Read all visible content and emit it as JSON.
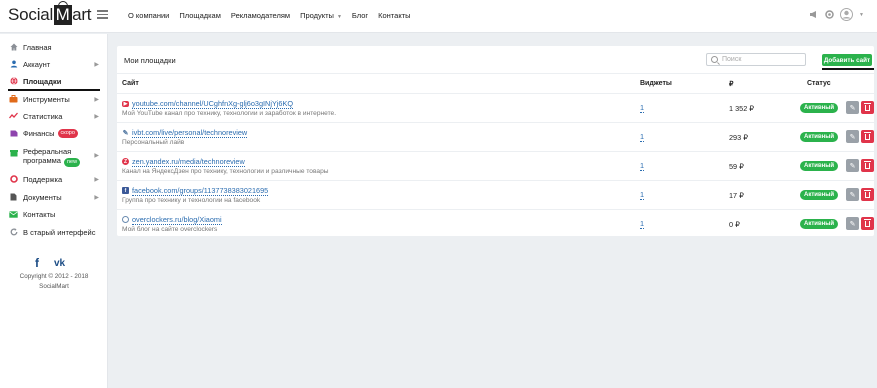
{
  "header": {
    "logo_pre": "Social",
    "logo_m": "M",
    "logo_post": "art",
    "nav": [
      "О компании",
      "Площадкам",
      "Рекламодателям",
      "Продукты",
      "Блог",
      "Контакты"
    ]
  },
  "sidebar": {
    "items": [
      {
        "label": "Главная",
        "icon": "home-icon",
        "color": "#8a8f96",
        "arrow": false
      },
      {
        "label": "Аккаунт",
        "icon": "user-icon",
        "color": "#2a6cb0",
        "arrow": true
      },
      {
        "label": "Площадки",
        "icon": "globe-icon",
        "color": "#e0344a",
        "arrow": false,
        "active": true
      },
      {
        "label": "Инструменты",
        "icon": "briefcase-icon",
        "color": "#e06a1a",
        "arrow": true
      },
      {
        "label": "Статистика",
        "icon": "chart-icon",
        "color": "#e0344a",
        "arrow": true
      },
      {
        "label": "Финансы",
        "icon": "wallet-icon",
        "color": "#8e44ad",
        "arrow": false,
        "badge": "скоро"
      },
      {
        "label": "Реферальная",
        "label2": "программа",
        "icon": "referral-icon",
        "color": "#2bb24c",
        "arrow": true,
        "badge": "new"
      },
      {
        "label": "Поддержка",
        "icon": "lifebuoy-icon",
        "color": "#e0344a",
        "arrow": true
      },
      {
        "label": "Документы",
        "icon": "document-icon",
        "color": "#555555",
        "arrow": true
      },
      {
        "label": "Контакты",
        "icon": "mail-icon",
        "color": "#2bb24c",
        "arrow": false
      },
      {
        "label": "В старый интерфейс",
        "icon": "refresh-icon",
        "color": "#8a8f96",
        "arrow": false
      }
    ],
    "copyright_line1": "Copyright © 2012 - 2018",
    "copyright_line2": "SocialMart"
  },
  "main": {
    "title": "Мои площадки",
    "search_placeholder": "Поиск",
    "add_button": "Добавить сайт",
    "columns": {
      "site": "Сайт",
      "widgets": "Виджеты",
      "price": "₽",
      "status": "Статус"
    },
    "rows": [
      {
        "url": "youtube.com/channel/UCghfnXg-glj6o3gINjYj6KQ",
        "desc": "Мой YouTube канал про технику, технологии и заработок в интернете.",
        "widgets": "1",
        "price": "1 352 ₽",
        "status": "Активный",
        "icon": "youtube-icon",
        "icon_color": "#e0344a"
      },
      {
        "url": "ivbt.com/live/personal/technoreview",
        "desc": "Персональный лайв",
        "widgets": "1",
        "price": "293 ₽",
        "status": "Активный",
        "icon": "livejournal-icon",
        "icon_color": "#5a7ea6"
      },
      {
        "url": "zen.yandex.ru/media/technoreview",
        "desc": "Канал на ЯндексДзен про технику, технологии и различные товары",
        "widgets": "1",
        "price": "59 ₽",
        "status": "Активный",
        "icon": "yandex-zen-icon",
        "icon_color": "#e0344a"
      },
      {
        "url": "facebook.com/groups/1137738383021695",
        "desc": "Группа про технику и технологии на facebook",
        "widgets": "1",
        "price": "17 ₽",
        "status": "Активный",
        "icon": "facebook-icon",
        "icon_color": "#3b5998"
      },
      {
        "url": "overclockers.ru/blog/Xiaomi",
        "desc": "Мой блог на сайте overclockers",
        "widgets": "1",
        "price": "0 ₽",
        "status": "Активный",
        "icon": "globe-icon",
        "icon_color": "#6a8bb0"
      }
    ]
  },
  "colors": {
    "accent": "#2bb24c",
    "danger": "#e0344a",
    "link": "#2a6cb0"
  }
}
